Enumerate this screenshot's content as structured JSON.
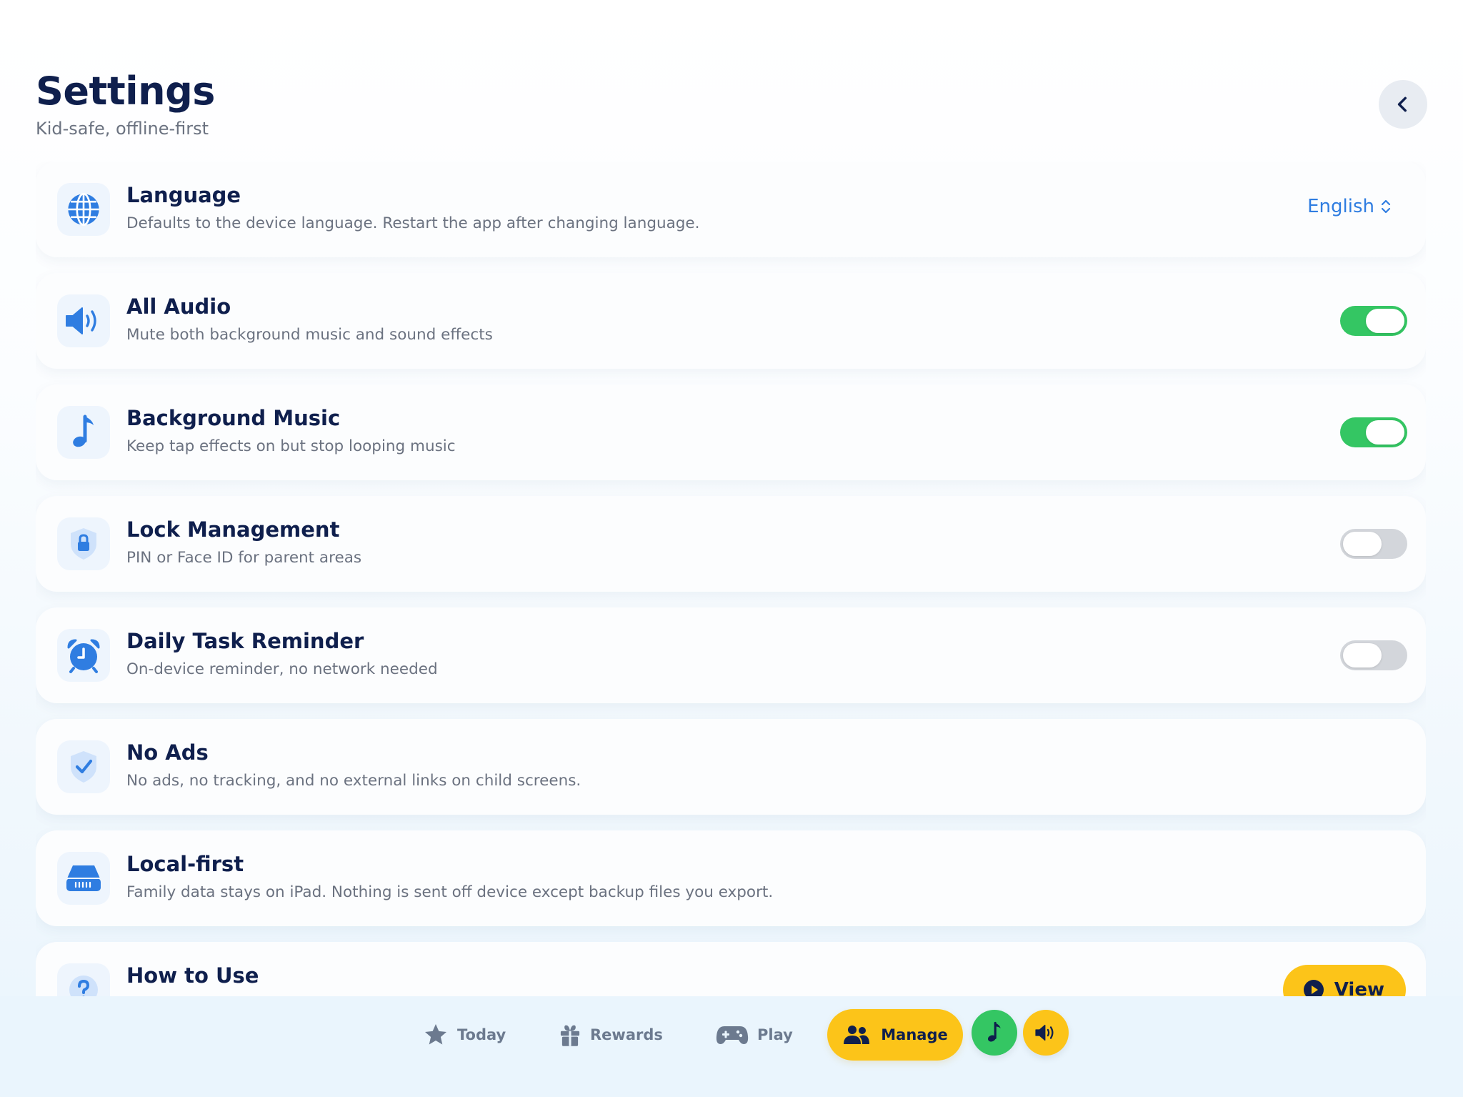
{
  "header": {
    "title": "Settings",
    "subtitle": "Kid-safe, offline-first",
    "back_icon": "chevron-left-icon"
  },
  "settings": {
    "language": {
      "title": "Language",
      "description": "Defaults to the device language. Restart the app after changing language.",
      "value": "English",
      "icon": "globe-icon"
    },
    "all_audio": {
      "title": "All Audio",
      "description": "Mute both background music and sound effects",
      "enabled": true,
      "icon": "speaker-icon"
    },
    "background_music": {
      "title": "Background Music",
      "description": "Keep tap effects on but stop looping music",
      "enabled": true,
      "icon": "music-note-icon"
    },
    "lock_management": {
      "title": "Lock Management",
      "description": "PIN or Face ID for parent areas",
      "enabled": false,
      "icon": "lock-shield-icon"
    },
    "daily_task_reminder": {
      "title": "Daily Task Reminder",
      "description": "On-device reminder, no network needed",
      "enabled": false,
      "icon": "alarm-clock-icon"
    },
    "no_ads": {
      "title": "No Ads",
      "description": "No ads, no tracking, and no external links on child screens.",
      "icon": "check-shield-icon"
    },
    "local_first": {
      "title": "Local-first",
      "description": "Family data stays on iPad. Nothing is sent off device except backup files you export.",
      "icon": "storage-drive-icon"
    },
    "how_to_use": {
      "title": "How to Use",
      "button_label": "View",
      "icon": "question-icon"
    }
  },
  "bottom_nav": {
    "items": [
      {
        "label": "Today",
        "icon": "star-icon"
      },
      {
        "label": "Rewards",
        "icon": "gift-icon"
      },
      {
        "label": "Play",
        "icon": "gamepad-icon"
      },
      {
        "label": "Manage",
        "icon": "family-icon",
        "active": true
      }
    ],
    "music_button_icon": "music-note-icon",
    "sound_button_icon": "speaker-icon"
  },
  "colors": {
    "accent_blue": "#2f7de1",
    "navy_text": "#0f1f4d",
    "toggle_on": "#34c663",
    "toggle_off": "#d3d6db",
    "highlight_yellow": "#fcc419",
    "music_green": "#34c663"
  }
}
